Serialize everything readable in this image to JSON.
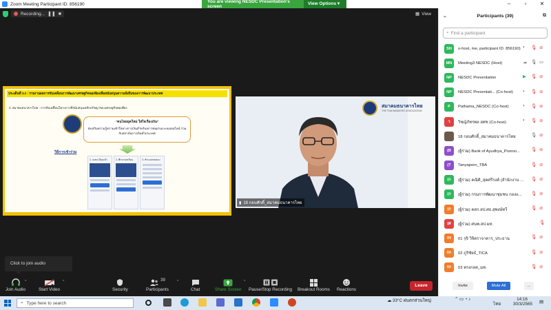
{
  "window": {
    "title": "Zoom Meeting Participant ID: 856190"
  },
  "share_banner": {
    "text": "You are viewing NESDC Presentation's screen",
    "view_options": "View Options"
  },
  "recording": {
    "label": "Recording..."
  },
  "view_button": {
    "label": "View"
  },
  "slide": {
    "header": "ประเด็นที่ 3.2 : รายงานผลการขับเคลื่อนการพัฒนาเศรษฐกิจพอเพียงเพื่อสนับสนุนความยั่งยืนของการพัฒนาประเทศ",
    "subhead": "4. สมาคมธนาคารไทย : การขับเคลื่อนโครงการที่สนับสนุนหลักปรัชญาของเศรษฐกิจพอเพียง",
    "quote_title": "“คนไทยยุคใหม่ ใส่ใจเรื่องเงิน”",
    "quote_body": "ส่งเสริมความรู้ความเข้าใจทางการเงินสำหรับเยาวชนผ่านระบบออนไลน์ ร่วมกับสถาบันการเงินทั่วประเทศ",
    "howto": "วิธีการเข้าร่วม",
    "shots": [
      "1. ลงทะเบียนเข้าร่วม",
      "2. ศึกษาบทเรียน",
      "3. ทำแบบทดสอบ"
    ]
  },
  "camera": {
    "brand_name": "สมาคมธนาคารไทย",
    "brand_en": "THE THAI BANKERS' ASSOCIATION",
    "name_label": "18 กอบศักดิ์_สมาคมธนาคารไทย"
  },
  "join_audio_tip": "Click to join audio",
  "toolbar": {
    "join_audio": "Join Audio",
    "start_video": "Start Video",
    "security": "Security",
    "participants": "Participants",
    "participants_count": "39",
    "chat": "Chat",
    "share_screen": "Share Screen",
    "pause_stop": "Pause/Stop Recording",
    "breakout": "Breakout Rooms",
    "reactions": "Reactions",
    "leave": "Leave"
  },
  "panel": {
    "title": "Participants (39)",
    "search_placeholder": "Find a participant",
    "invite": "Invite",
    "mute_all": "Mute All",
    "more": "...",
    "participants": [
      {
        "initials": "SN",
        "name": "o-host, me, participant ID: 856190)",
        "color": "#2eb85c",
        "icons": [
          "share",
          "mic-muted",
          "video-off"
        ]
      },
      {
        "initials": "MN",
        "name": "Meeting3 NESDC (Host)",
        "color": "#2eb85c",
        "icons": [
          "cloud",
          "mic",
          "video"
        ]
      },
      {
        "initials": "NP",
        "name": "NESDC Presentation",
        "color": "#2eb85c",
        "icons": [
          "screen",
          "mic-muted",
          "video-off"
        ]
      },
      {
        "initials": "NP",
        "name": "NESDC Presentati... (Co-host)",
        "color": "#2eb85c",
        "icons": [
          "share",
          "mic-muted",
          "video-off"
        ]
      },
      {
        "initials": "P",
        "name": "Pathama_NESDC (Co-host)",
        "color": "#2eb85c",
        "icons": [
          "share",
          "mic-muted",
          "video-off"
        ]
      },
      {
        "initials": "ว",
        "name": "วิชญ์ภัทรพล สศช (Co-host)",
        "color": "#e04141",
        "icons": [
          "share",
          "mic-muted",
          "video-off"
        ]
      },
      {
        "initials": "",
        "name": "18 กอบศักดิ์_สมาคมธนาคารไทย",
        "color": "#6b5a4a",
        "icons": [
          "mic",
          "video-off"
        ]
      },
      {
        "initials": "(B",
        "name": "(ผู้ร่วม) Bank of Ayudhya_Poonsi...",
        "color": "#8e4fc9",
        "icons": [
          "mic-muted",
          "video-off"
        ]
      },
      {
        "initials": "(T",
        "name": "Tanyaporn_TBA",
        "color": "#8e4fc9",
        "icons": [
          "mic-muted",
          "video-off"
        ]
      },
      {
        "initials": "(ก",
        "name": "(ผู้ร่วม) คณิติ_สุดศรีรงค์ (สำนักงาน ...",
        "color": "#2eb85c",
        "icons": [
          "mic-muted",
          "video-off"
        ]
      },
      {
        "initials": "(ก",
        "name": "(ผู้ร่วม) กรมการพัฒนาชุมชน กองแ...",
        "color": "#2eb85c",
        "icons": [
          "mic-muted",
          "video-off"
        ]
      },
      {
        "initials": "(ก",
        "name": "(ผู้ร่วม) คสก.สป.ศธ.สุพงษ์ทวี",
        "color": "#f07d2b",
        "icons": [
          "mic-muted",
          "video-off"
        ]
      },
      {
        "initials": "(ศ",
        "name": "(ผู้ร่วม) ศนพ.สป.มท.",
        "color": "#e04141",
        "icons": [
          "mic-muted"
        ]
      },
      {
        "initials": "0ร",
        "name": "01 รุจิ วิจิตราจาคาร_ประธาน",
        "color": "#f07d2b",
        "icons": [
          "mic-muted",
          "video-off"
        ]
      },
      {
        "initials": "0ก",
        "name": "02 ภูริชัยธ์_TICA",
        "color": "#f07d2b",
        "icons": [
          "mic-muted",
          "video-off"
        ]
      },
      {
        "initials": "0ก",
        "name": "03 ทรงกลด_มท.",
        "color": "#f07d2b",
        "icons": [
          "mic-muted",
          "video-off"
        ]
      }
    ]
  },
  "taskbar": {
    "search_placeholder": "Type here to search",
    "weather": "33°C ฝนตกส่วนใหญ่",
    "lang": "ไทย",
    "time": "14:16",
    "date": "30/3/2565"
  }
}
